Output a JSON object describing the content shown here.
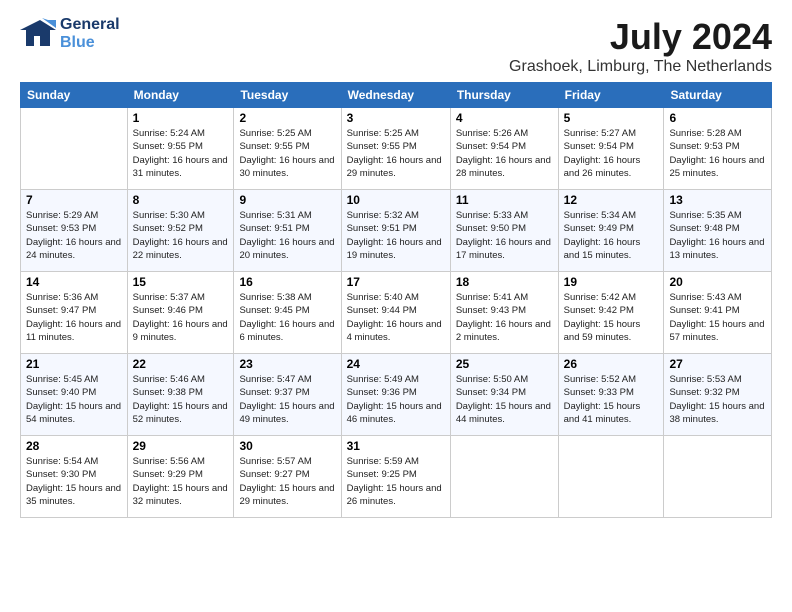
{
  "logo": {
    "line1": "General",
    "line2": "Blue"
  },
  "header": {
    "month": "July 2024",
    "location": "Grashoek, Limburg, The Netherlands"
  },
  "weekdays": [
    "Sunday",
    "Monday",
    "Tuesday",
    "Wednesday",
    "Thursday",
    "Friday",
    "Saturday"
  ],
  "weeks": [
    [
      {
        "day": "",
        "empty": true
      },
      {
        "day": "1",
        "sunrise": "5:24 AM",
        "sunset": "9:55 PM",
        "daylight": "16 hours and 31 minutes."
      },
      {
        "day": "2",
        "sunrise": "5:25 AM",
        "sunset": "9:55 PM",
        "daylight": "16 hours and 30 minutes."
      },
      {
        "day": "3",
        "sunrise": "5:25 AM",
        "sunset": "9:55 PM",
        "daylight": "16 hours and 29 minutes."
      },
      {
        "day": "4",
        "sunrise": "5:26 AM",
        "sunset": "9:54 PM",
        "daylight": "16 hours and 28 minutes."
      },
      {
        "day": "5",
        "sunrise": "5:27 AM",
        "sunset": "9:54 PM",
        "daylight": "16 hours and 26 minutes."
      },
      {
        "day": "6",
        "sunrise": "5:28 AM",
        "sunset": "9:53 PM",
        "daylight": "16 hours and 25 minutes."
      }
    ],
    [
      {
        "day": "7",
        "sunrise": "5:29 AM",
        "sunset": "9:53 PM",
        "daylight": "16 hours and 24 minutes."
      },
      {
        "day": "8",
        "sunrise": "5:30 AM",
        "sunset": "9:52 PM",
        "daylight": "16 hours and 22 minutes."
      },
      {
        "day": "9",
        "sunrise": "5:31 AM",
        "sunset": "9:51 PM",
        "daylight": "16 hours and 20 minutes."
      },
      {
        "day": "10",
        "sunrise": "5:32 AM",
        "sunset": "9:51 PM",
        "daylight": "16 hours and 19 minutes."
      },
      {
        "day": "11",
        "sunrise": "5:33 AM",
        "sunset": "9:50 PM",
        "daylight": "16 hours and 17 minutes."
      },
      {
        "day": "12",
        "sunrise": "5:34 AM",
        "sunset": "9:49 PM",
        "daylight": "16 hours and 15 minutes."
      },
      {
        "day": "13",
        "sunrise": "5:35 AM",
        "sunset": "9:48 PM",
        "daylight": "16 hours and 13 minutes."
      }
    ],
    [
      {
        "day": "14",
        "sunrise": "5:36 AM",
        "sunset": "9:47 PM",
        "daylight": "16 hours and 11 minutes."
      },
      {
        "day": "15",
        "sunrise": "5:37 AM",
        "sunset": "9:46 PM",
        "daylight": "16 hours and 9 minutes."
      },
      {
        "day": "16",
        "sunrise": "5:38 AM",
        "sunset": "9:45 PM",
        "daylight": "16 hours and 6 minutes."
      },
      {
        "day": "17",
        "sunrise": "5:40 AM",
        "sunset": "9:44 PM",
        "daylight": "16 hours and 4 minutes."
      },
      {
        "day": "18",
        "sunrise": "5:41 AM",
        "sunset": "9:43 PM",
        "daylight": "16 hours and 2 minutes."
      },
      {
        "day": "19",
        "sunrise": "5:42 AM",
        "sunset": "9:42 PM",
        "daylight": "15 hours and 59 minutes."
      },
      {
        "day": "20",
        "sunrise": "5:43 AM",
        "sunset": "9:41 PM",
        "daylight": "15 hours and 57 minutes."
      }
    ],
    [
      {
        "day": "21",
        "sunrise": "5:45 AM",
        "sunset": "9:40 PM",
        "daylight": "15 hours and 54 minutes."
      },
      {
        "day": "22",
        "sunrise": "5:46 AM",
        "sunset": "9:38 PM",
        "daylight": "15 hours and 52 minutes."
      },
      {
        "day": "23",
        "sunrise": "5:47 AM",
        "sunset": "9:37 PM",
        "daylight": "15 hours and 49 minutes."
      },
      {
        "day": "24",
        "sunrise": "5:49 AM",
        "sunset": "9:36 PM",
        "daylight": "15 hours and 46 minutes."
      },
      {
        "day": "25",
        "sunrise": "5:50 AM",
        "sunset": "9:34 PM",
        "daylight": "15 hours and 44 minutes."
      },
      {
        "day": "26",
        "sunrise": "5:52 AM",
        "sunset": "9:33 PM",
        "daylight": "15 hours and 41 minutes."
      },
      {
        "day": "27",
        "sunrise": "5:53 AM",
        "sunset": "9:32 PM",
        "daylight": "15 hours and 38 minutes."
      }
    ],
    [
      {
        "day": "28",
        "sunrise": "5:54 AM",
        "sunset": "9:30 PM",
        "daylight": "15 hours and 35 minutes."
      },
      {
        "day": "29",
        "sunrise": "5:56 AM",
        "sunset": "9:29 PM",
        "daylight": "15 hours and 32 minutes."
      },
      {
        "day": "30",
        "sunrise": "5:57 AM",
        "sunset": "9:27 PM",
        "daylight": "15 hours and 29 minutes."
      },
      {
        "day": "31",
        "sunrise": "5:59 AM",
        "sunset": "9:25 PM",
        "daylight": "15 hours and 26 minutes."
      },
      {
        "day": "",
        "empty": true
      },
      {
        "day": "",
        "empty": true
      },
      {
        "day": "",
        "empty": true
      }
    ]
  ],
  "labels": {
    "sunrise": "Sunrise:",
    "sunset": "Sunset:",
    "daylight": "Daylight:"
  }
}
